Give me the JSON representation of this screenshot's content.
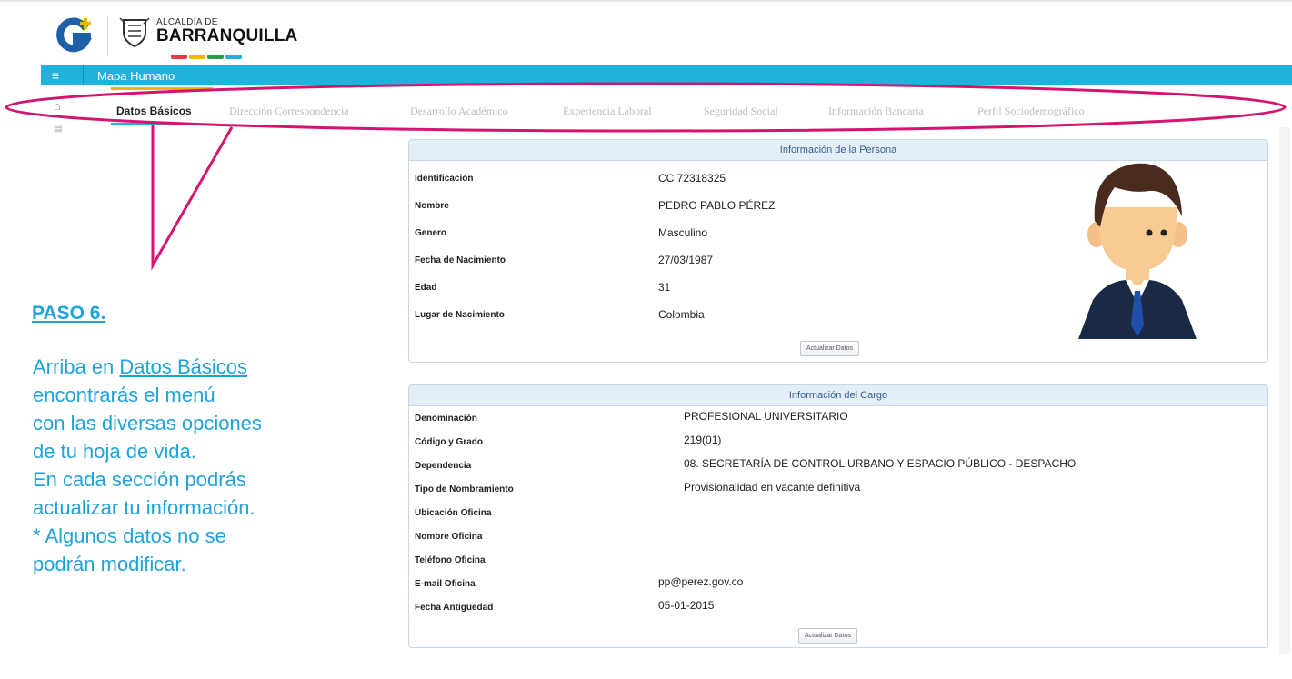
{
  "header": {
    "alcaldia_small": "ALCALDÍA DE",
    "alcaldia_big": "BARRANQUILLA",
    "strip_colors": [
      "#e63946",
      "#f2b705",
      "#2a9d4a",
      "#1fb2dd"
    ]
  },
  "bar": {
    "title": "Mapa Humano"
  },
  "tabs": [
    {
      "label": "Datos Básicos",
      "active": true
    },
    {
      "label": "Dirección Correspondencia"
    },
    {
      "label": "Desarrollo Académico"
    },
    {
      "label": "Experiencia Laboral"
    },
    {
      "label": "Seguridad Social"
    },
    {
      "label": "Información Bancaria"
    },
    {
      "label": "Perfil Sociodemográfico"
    }
  ],
  "instructions": {
    "title": "PASO 6.",
    "line1_a": "Arriba en ",
    "line1_link": "Datos Básicos",
    "line2": "encontrarás el menú",
    "line3": "con las diversas opciones",
    "line4": "de tu hoja de vida.",
    "line5": "En cada sección podrás",
    "line6": "actualizar tu información.",
    "line7": "* Algunos datos no se",
    "line8": "podrán modificar."
  },
  "persona": {
    "title": "Información de la Persona",
    "rows": [
      {
        "label": "Identificación",
        "value": "CC 72318325"
      },
      {
        "label": "Nombre",
        "value": "PEDRO PABLO PÉREZ"
      },
      {
        "label": "Genero",
        "value": "Masculino"
      },
      {
        "label": "Fecha de Nacimiento",
        "value": "27/03/1987"
      },
      {
        "label": "Edad",
        "value": "31"
      },
      {
        "label": "Lugar de Nacimiento",
        "value": "Colombia"
      }
    ],
    "button": "Actualizar Datos"
  },
  "cargo": {
    "title": "Información del Cargo",
    "rows": [
      {
        "label": "Denominación",
        "value": "PROFESIONAL UNIVERSITARIO"
      },
      {
        "label": "Código y Grado",
        "value": "219(01)"
      },
      {
        "label": "Dependencia",
        "value": "08. SECRETARÍA DE CONTROL URBANO Y ESPACIO  PÚBLICO - DESPACHO"
      },
      {
        "label": "Tipo de Nombramiento",
        "value": "Provisionalidad en vacante definitiva"
      },
      {
        "label": "Ubicación Oficina",
        "value": ""
      },
      {
        "label": "Nombre Oficina",
        "value": ""
      },
      {
        "label": "Teléfono Oficina",
        "value": ""
      },
      {
        "label": "E-mail Oficina",
        "value": "pp@perez.gov.co"
      },
      {
        "label": "Fecha Antigüedad",
        "value": "05-01-2015"
      }
    ],
    "button": "Actualizar Datos"
  },
  "callout_color": "#d4146f",
  "accent": "#1fb2dd"
}
